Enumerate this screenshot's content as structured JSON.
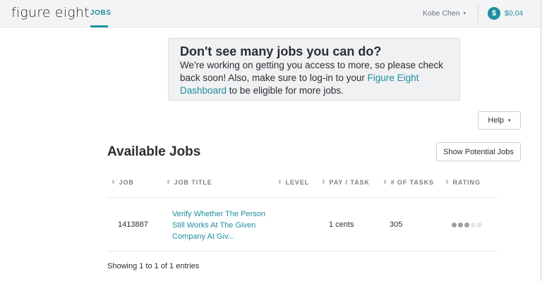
{
  "header": {
    "logo_text": "figure eight",
    "nav_jobs": "JOBS",
    "user_name": "Kobe Chen",
    "user_caret": "▾",
    "balance_symbol": "$",
    "balance": "$0.04"
  },
  "notice": {
    "title": "Don't see many jobs you can do?",
    "body_1": "We're working on getting you access to more, so please check back soon! Also, make sure to log-in to your ",
    "link": "Figure Eight Dashboard",
    "body_2": " to be eligible for more jobs."
  },
  "help_button": {
    "label": "Help",
    "caret": "▾"
  },
  "section": {
    "title": "Available Jobs",
    "potential_button": "Show Potential Jobs"
  },
  "table": {
    "columns": [
      "JOB",
      "JOB TITLE",
      "LEVEL",
      "PAY / TASK",
      "# OF TASKS",
      "RATING"
    ],
    "sort_icon": "⬍",
    "rows": [
      {
        "job": "1413887",
        "title": "Verify Whether The Person Still Works At The Given Company At Giv...",
        "level": "",
        "pay": "1 cents",
        "tasks": "305",
        "rating": 3,
        "rating_max": 5
      }
    ]
  },
  "footer": {
    "info": "Showing 1 to 1 of 1 entries"
  }
}
